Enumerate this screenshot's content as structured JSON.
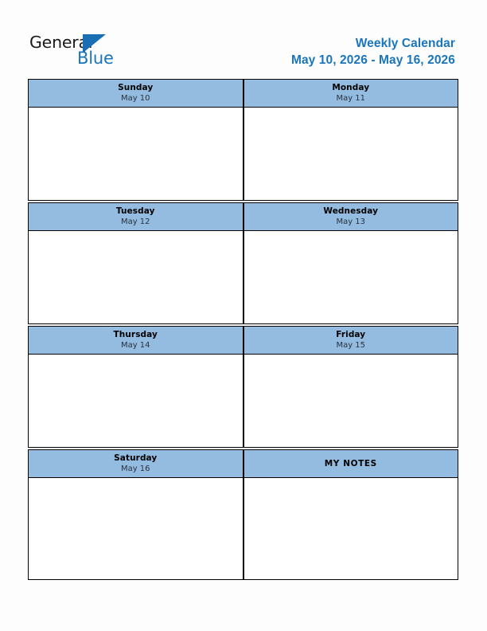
{
  "brand": {
    "name_part1": "General",
    "name_part2": "Blue",
    "mark": "triangle-logo",
    "color_dark": "#1a1a1a",
    "color_blue": "#1a75bc"
  },
  "header": {
    "title": "Weekly Calendar",
    "date_range": "May 10, 2026 - May 16, 2026",
    "title_color": "#1a75bc"
  },
  "theme": {
    "header_cell_bg": "#94bce0",
    "body_cell_bg": "#ffffff",
    "border_color": "#000000",
    "page_bg": "#fdfdfd",
    "date_text_color": "#28323e"
  },
  "calendar": {
    "rows": [
      {
        "cells": [
          {
            "day": "Sunday",
            "date": "May 10",
            "content": ""
          },
          {
            "day": "Monday",
            "date": "May 11",
            "content": ""
          }
        ]
      },
      {
        "cells": [
          {
            "day": "Tuesday",
            "date": "May 12",
            "content": ""
          },
          {
            "day": "Wednesday",
            "date": "May 13",
            "content": ""
          }
        ]
      },
      {
        "cells": [
          {
            "day": "Thursday",
            "date": "May 14",
            "content": ""
          },
          {
            "day": "Friday",
            "date": "May 15",
            "content": ""
          }
        ]
      },
      {
        "cells": [
          {
            "day": "Saturday",
            "date": "May 16",
            "content": ""
          },
          {
            "day": "MY NOTES",
            "date": "",
            "content": ""
          }
        ]
      }
    ]
  }
}
